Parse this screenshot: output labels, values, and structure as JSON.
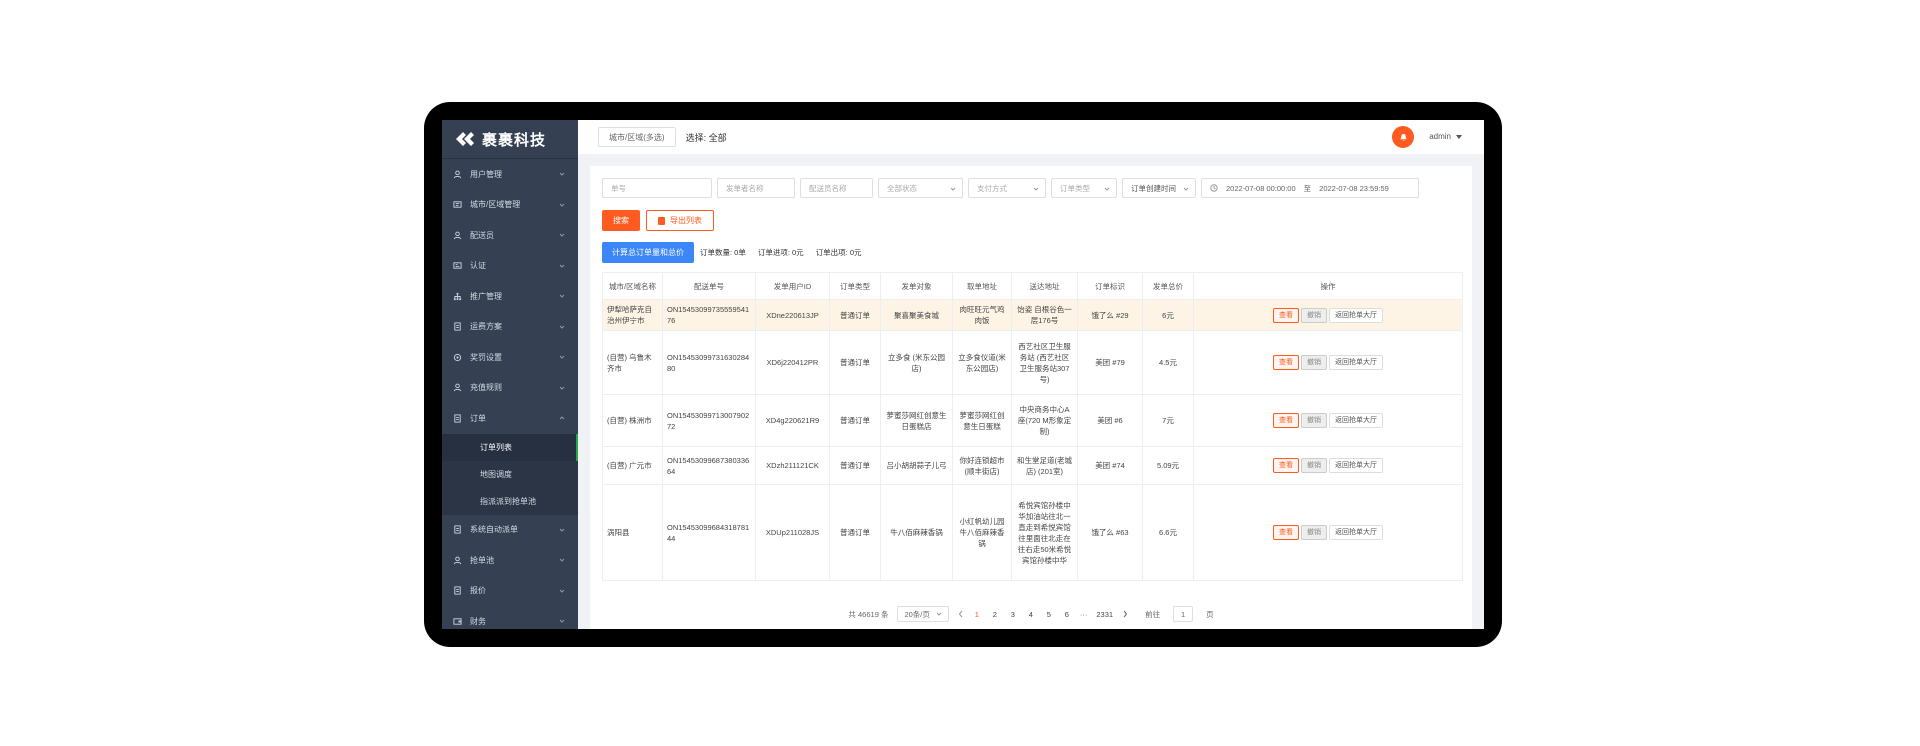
{
  "brand": {
    "name": "裹裹科技"
  },
  "sidebar": {
    "items": [
      {
        "label": "用户管理",
        "icon": "user-icon"
      },
      {
        "label": "城市/区域管理",
        "icon": "city-icon"
      },
      {
        "label": "配送员",
        "icon": "user-icon"
      },
      {
        "label": "认证",
        "icon": "id-card-icon"
      },
      {
        "label": "推广管理",
        "icon": "org-icon"
      },
      {
        "label": "运费方案",
        "icon": "doc-icon"
      },
      {
        "label": "奖罚设置",
        "icon": "settings-icon"
      },
      {
        "label": "充值规则",
        "icon": "user-icon"
      },
      {
        "label": "订单",
        "icon": "doc-icon",
        "expanded": true
      }
    ],
    "sub_items": [
      {
        "label": "订单列表",
        "active": true
      },
      {
        "label": "地图调度"
      },
      {
        "label": "指派派到抢单池"
      }
    ],
    "items_after": [
      {
        "label": "系统自动派单",
        "icon": "doc-icon"
      },
      {
        "label": "抢单池",
        "icon": "user-icon"
      },
      {
        "label": "报价",
        "icon": "doc-icon"
      },
      {
        "label": "财务",
        "icon": "wallet-icon"
      }
    ]
  },
  "topbar": {
    "city_button": "城市/区域(多选)",
    "selection": "选择: 全部",
    "user": "admin"
  },
  "filters": {
    "order_no": "单号",
    "sender": "发单者名称",
    "courier": "配送员名称",
    "status": "全部状态",
    "payment": "支付方式",
    "order_type": "订单类型",
    "time_type": "订单创建时间",
    "date_start": "2022-07-08 00:00:00",
    "date_sep": "至",
    "date_end": "2022-07-08 23:59:59"
  },
  "actions": {
    "search": "搜索",
    "export": "导出列表",
    "calc": "计算总订单量和总价"
  },
  "stats": {
    "count": "订单数量: 0单",
    "income": "订单进项: 0元",
    "expense": "订单出项: 0元"
  },
  "table": {
    "columns": [
      "城市/区域名称",
      "配送单号",
      "发单用户ID",
      "订单类型",
      "发单对象",
      "取单地址",
      "送达地址",
      "订单标识",
      "发单总价",
      "操作"
    ],
    "op_labels": {
      "view": "查看",
      "cancel": "撤销",
      "return": "返回抢单大厅"
    },
    "rows": [
      {
        "city": "伊犁哈萨克自治州伊宁市",
        "order_no": "ON1545309973555954176",
        "user_id": "XDne220613JP",
        "type": "普通订单",
        "target": "聚喜聚美食城",
        "pickup": "肉旺旺元气鸡肉饭",
        "dropoff": "饴姿 自根谷色一层176号",
        "tag": "饿了么 #29",
        "price": "6元"
      },
      {
        "city": "(自营) 乌鲁木齐市",
        "order_no": "ON1545309973163028480",
        "user_id": "XD6j220412PR",
        "type": "普通订单",
        "target": "立多食 (米东公园店)",
        "pickup": "立多食仪道(米东公园店)",
        "dropoff": "西艺社区卫生服务站 (西艺社区卫生服务站307号)",
        "tag": "美团 #79",
        "price": "4.5元"
      },
      {
        "city": "(自营) 株洲市",
        "order_no": "ON1545309971300790272",
        "user_id": "XD4g220621R9",
        "type": "普通订单",
        "target": "萝蜜莎网红创意生日蛋糕店",
        "pickup": "萝蜜莎网红创意生日蛋糕",
        "dropoff": "中央商务中心A座(720 M形象定制)",
        "tag": "美团 #6",
        "price": "7元"
      },
      {
        "city": "(自营) 广元市",
        "order_no": "ON1545309968738033664",
        "user_id": "XDzh211121CK",
        "type": "普通订单",
        "target": "吕小胡胡蒜子儿弓",
        "pickup": "你好连锁超市(顺丰街店)",
        "dropoff": "和生堂足道(老城店) (201室)",
        "tag": "美团 #74",
        "price": "5.09元"
      },
      {
        "city": "涡阳县",
        "order_no": "ON1545309968431878144",
        "user_id": "XDUp211028JS",
        "type": "普通订单",
        "target": "牛八佰麻辣香锅",
        "pickup": "小红帆幼儿园牛八佰麻辣香锅",
        "dropoff": "希悦宾馆孙楼中华加油站往北一直走到希悦宾馆往里面往北走在往右走50米希悦宾馆孙楼中华",
        "tag": "饿了么 #63",
        "price": "6.6元"
      }
    ]
  },
  "pagination": {
    "total": "共 46619 条",
    "page_size": "20条/页",
    "pages": [
      "1",
      "2",
      "3",
      "4",
      "5",
      "6"
    ],
    "ellipsis": "···",
    "last": "2331",
    "goto_prefix": "前往",
    "goto_value": "1",
    "goto_suffix": "页"
  },
  "colors": {
    "accent": "#ff5a1f",
    "sidebar": "#354052",
    "primary": "#3d86f7",
    "highlight_row": "#fdf4e6"
  }
}
